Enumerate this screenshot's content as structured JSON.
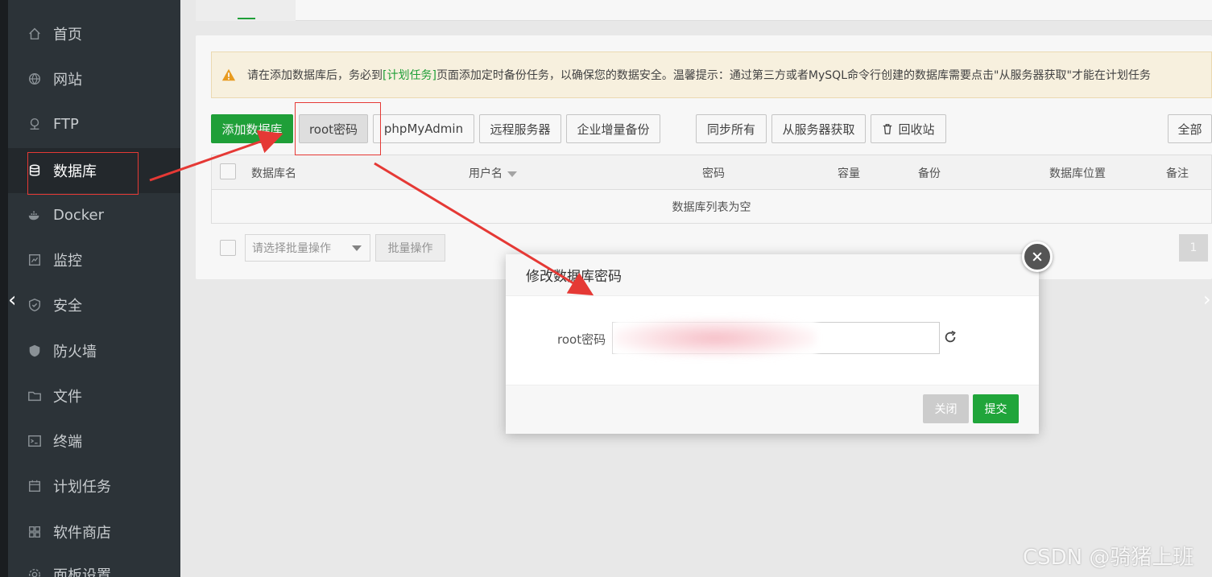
{
  "sidebar": {
    "items": [
      {
        "label": "首页",
        "icon": "home-icon"
      },
      {
        "label": "网站",
        "icon": "globe-icon"
      },
      {
        "label": "FTP",
        "icon": "ftp-icon"
      },
      {
        "label": "数据库",
        "icon": "database-icon",
        "active": true
      },
      {
        "label": "Docker",
        "icon": "docker-icon"
      },
      {
        "label": "监控",
        "icon": "monitor-icon"
      },
      {
        "label": "安全",
        "icon": "shield-icon"
      },
      {
        "label": "防火墙",
        "icon": "firewall-icon"
      },
      {
        "label": "文件",
        "icon": "folder-icon"
      },
      {
        "label": "终端",
        "icon": "terminal-icon"
      },
      {
        "label": "计划任务",
        "icon": "calendar-icon"
      },
      {
        "label": "软件商店",
        "icon": "grid-icon"
      },
      {
        "label": "面板设置",
        "icon": "gear-icon"
      }
    ]
  },
  "notice": {
    "text_before": "请在添加数据库后，务必到",
    "link": "[计划任务]",
    "text_after": "页面添加定时备份任务，以确保您的数据安全。温馨提示：通过第三方或者MySQL命令行创建的数据库需要点击\"从服务器获取\"才能在计划任务"
  },
  "toolbar": {
    "add_db": "添加数据库",
    "root_pwd": "root密码",
    "phpmyadmin": "phpMyAdmin",
    "remote_server": "远程服务器",
    "enterprise_backup": "企业增量备份",
    "sync_all": "同步所有",
    "fetch_from_server": "从服务器获取",
    "recycle_bin": "回收站",
    "all": "全部"
  },
  "table": {
    "headers": {
      "name": "数据库名",
      "user": "用户名",
      "password": "密码",
      "capacity": "容量",
      "backup": "备份",
      "location": "数据库位置",
      "note": "备注"
    },
    "empty": "数据库列表为空"
  },
  "footer": {
    "batch_placeholder": "请选择批量操作",
    "batch_button": "批量操作",
    "page": "1"
  },
  "modal": {
    "title": "修改数据库密码",
    "label": "root密码",
    "close": "关闭",
    "submit": "提交"
  },
  "watermark": "CSDN @骑猪上班",
  "colors": {
    "accent": "#20a53a",
    "sidebar": "#2c3338",
    "annotation": "#e53935"
  }
}
